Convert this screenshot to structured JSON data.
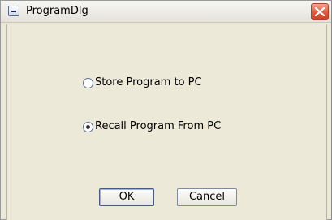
{
  "window": {
    "title": "ProgramDlg"
  },
  "options": [
    {
      "label": "Store Program to PC",
      "checked": false
    },
    {
      "label": "Recall Program From PC",
      "checked": true
    }
  ],
  "buttons": {
    "ok_label": "OK",
    "cancel_label": "Cancel"
  },
  "icons": {
    "system_menu": "system-menu-icon",
    "close": "close-icon"
  },
  "colors": {
    "dialog_background": "#ece9d8",
    "close_button": "#de5a3a"
  }
}
